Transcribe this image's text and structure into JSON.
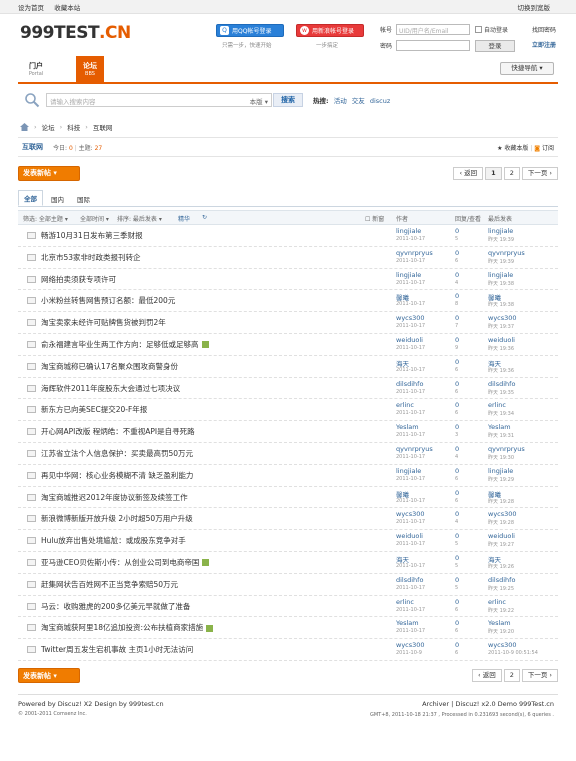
{
  "topbar": {
    "set_home": "设为首页",
    "bookmark": "收藏本站",
    "switch": "切换到宽版"
  },
  "logo": {
    "main": "999TEST",
    "suffix": ".CN"
  },
  "social": {
    "qq_label": "用QQ帐号登录",
    "qq_sub": "只需一步，快速开始",
    "weibo_label": "用新浪帐号登录",
    "weibo_sub": "一步搞定"
  },
  "login": {
    "user_label": "帐号",
    "user_placeholder": "UID/用户名/Email",
    "auto_login": "自动登录",
    "find_pw": "找回密码",
    "pw_label": "密码",
    "login_btn": "登录",
    "register": "立即注册"
  },
  "nav": {
    "tabs": [
      {
        "title": "门户",
        "sub": "Portal"
      },
      {
        "title": "论坛",
        "sub": "BBS"
      }
    ],
    "quick": "快捷导航"
  },
  "search": {
    "placeholder": "请输入搜索内容",
    "scope": "本版",
    "button": "搜索",
    "hot_label": "热搜:",
    "hot": [
      "活动",
      "交友",
      "discuz"
    ]
  },
  "breadcrumb": [
    "论坛",
    "科技",
    "互联网"
  ],
  "forum": {
    "name": "互联网",
    "today_label": "今日:",
    "today": "0",
    "topics_label": "主题:",
    "topics": "27",
    "fav": "收藏本版",
    "rss": "订阅"
  },
  "post_btn": "发表新帖",
  "pager": {
    "back": "返回",
    "pages": [
      "1",
      "2"
    ],
    "next": "下一页"
  },
  "type_tabs": [
    "全部",
    "国内",
    "国际"
  ],
  "thead": {
    "filter": "筛选: 全部主题",
    "time": "全部时间",
    "sort": "排序: 最后发表",
    "digest": "精华",
    "newwin": "新窗",
    "author": "作者",
    "replies": "回复/查看",
    "last": "最后发表"
  },
  "threads": [
    {
      "title": "畅游10月31日发布第三季财报",
      "author": "lingjiale",
      "date": "2011-10-17",
      "r": "0",
      "v": "5",
      "last": "lingjiale",
      "ltime": "昨天 19:39",
      "att": false
    },
    {
      "title": "北京市53家非时政类报刊转企",
      "author": "qyvnrpryus",
      "date": "2011-10-17",
      "r": "0",
      "v": "6",
      "last": "qyvnrpryus",
      "ltime": "昨天 19:39",
      "att": false
    },
    {
      "title": "网络拍卖须获专项许可",
      "author": "lingjiale",
      "date": "2011-10-17",
      "r": "0",
      "v": "4",
      "last": "lingjiale",
      "ltime": "昨天 19:38",
      "att": false
    },
    {
      "title": "小米粉丝转售网售预订名额：最低200元",
      "author": "馨曦",
      "date": "2011-10-17",
      "r": "0",
      "v": "8",
      "last": "馨曦",
      "ltime": "昨天 19:38",
      "att": false
    },
    {
      "title": "淘宝卖家未经许可贴牌售货被判罚2年",
      "author": "wycs300",
      "date": "2011-10-17",
      "r": "0",
      "v": "7",
      "last": "wycs300",
      "ltime": "昨天 19:37",
      "att": false
    },
    {
      "title": "俞永福建言毕业生两工作方向：足够低或足够高",
      "author": "weiduoli",
      "date": "2011-10-17",
      "r": "0",
      "v": "9",
      "last": "weiduoli",
      "ltime": "昨天 19:36",
      "att": true
    },
    {
      "title": "淘宝商城称已确认17名聚众围攻商警身份",
      "author": "海天",
      "date": "2011-10-17",
      "r": "0",
      "v": "6",
      "last": "海天",
      "ltime": "昨天 19:36",
      "att": false
    },
    {
      "title": "海辉软件2011年度股东大会通过七项决议",
      "author": "dilsdihfo",
      "date": "2011-10-17",
      "r": "0",
      "v": "6",
      "last": "dilsdihfo",
      "ltime": "昨天 19:35",
      "att": false
    },
    {
      "title": "新东方已向美SEC提交20-F年报",
      "author": "erlinc",
      "date": "2011-10-17",
      "r": "0",
      "v": "6",
      "last": "erlinc",
      "ltime": "昨天 19:34",
      "att": false
    },
    {
      "title": "开心网API改版 程炳皓：不重视API是自寻死路",
      "author": "Yeslam",
      "date": "2011-10-17",
      "r": "0",
      "v": "3",
      "last": "Yeslam",
      "ltime": "昨天 19:31",
      "att": false
    },
    {
      "title": "江苏省立法个人信息保护：买卖最高罚50万元",
      "author": "qyvnrpryus",
      "date": "2011-10-17",
      "r": "0",
      "v": "4",
      "last": "qyvnrpryus",
      "ltime": "昨天 19:30",
      "att": false
    },
    {
      "title": "再见中华网：核心业务模糊不清 缺乏盈利能力",
      "author": "lingjiale",
      "date": "2011-10-17",
      "r": "0",
      "v": "6",
      "last": "lingjiale",
      "ltime": "昨天 19:29",
      "att": false
    },
    {
      "title": "淘宝商城推迟2012年度协议新签及续签工作",
      "author": "馨曦",
      "date": "2011-10-17",
      "r": "0",
      "v": "6",
      "last": "馨曦",
      "ltime": "昨天 19:28",
      "att": false
    },
    {
      "title": "新浪微博新版开放升级 2小时超50万用户升级",
      "author": "wycs300",
      "date": "2011-10-17",
      "r": "0",
      "v": "4",
      "last": "wycs300",
      "ltime": "昨天 19:28",
      "att": false
    },
    {
      "title": "Hulu放弃出售处境尴尬：或成股东竞争对手",
      "author": "weiduoli",
      "date": "2011-10-17",
      "r": "0",
      "v": "5",
      "last": "weiduoli",
      "ltime": "昨天 19:27",
      "att": false
    },
    {
      "title": "亚马逊CEO贝佐斯小传：从创业公司到电商帝国",
      "author": "海天",
      "date": "2011-10-17",
      "r": "0",
      "v": "5",
      "last": "海天",
      "ltime": "昨天 19:26",
      "att": true
    },
    {
      "title": "赶集网状告百姓网不正当竞争索赔50万元",
      "author": "dilsdihfo",
      "date": "2011-10-17",
      "r": "0",
      "v": "5",
      "last": "dilsdihfo",
      "ltime": "昨天 19:25",
      "att": false
    },
    {
      "title": "马云：收购雅虎的200多亿美元早就做了准备",
      "author": "erlinc",
      "date": "2011-10-17",
      "r": "0",
      "v": "6",
      "last": "erlinc",
      "ltime": "昨天 19:22",
      "att": false
    },
    {
      "title": "淘宝商城获阿里18亿追加投资:公布扶植商家措施",
      "author": "Yeslam",
      "date": "2011-10-17",
      "r": "0",
      "v": "6",
      "last": "Yeslam",
      "ltime": "昨天 19:20",
      "att": true
    },
    {
      "title": "Twitter周五发生宕机事故 主页1小时无法访问",
      "author": "wycs300",
      "date": "2011-10-9",
      "r": "0",
      "v": "6",
      "last": "wycs300",
      "ltime": "2011-10-9 00:51:54",
      "att": false
    }
  ],
  "footer": {
    "powered": "Powered by Discuz! X2 Design by 999test.cn",
    "copyright": "© 2001-2011 Comsenz Inc.",
    "right": "Archiver | Discuz! x2.0 Demo 999Test.cn",
    "stats": "GMT+8, 2011-10-18 21:37 , Processed in 0.231693 second(s), 6 queries ."
  }
}
